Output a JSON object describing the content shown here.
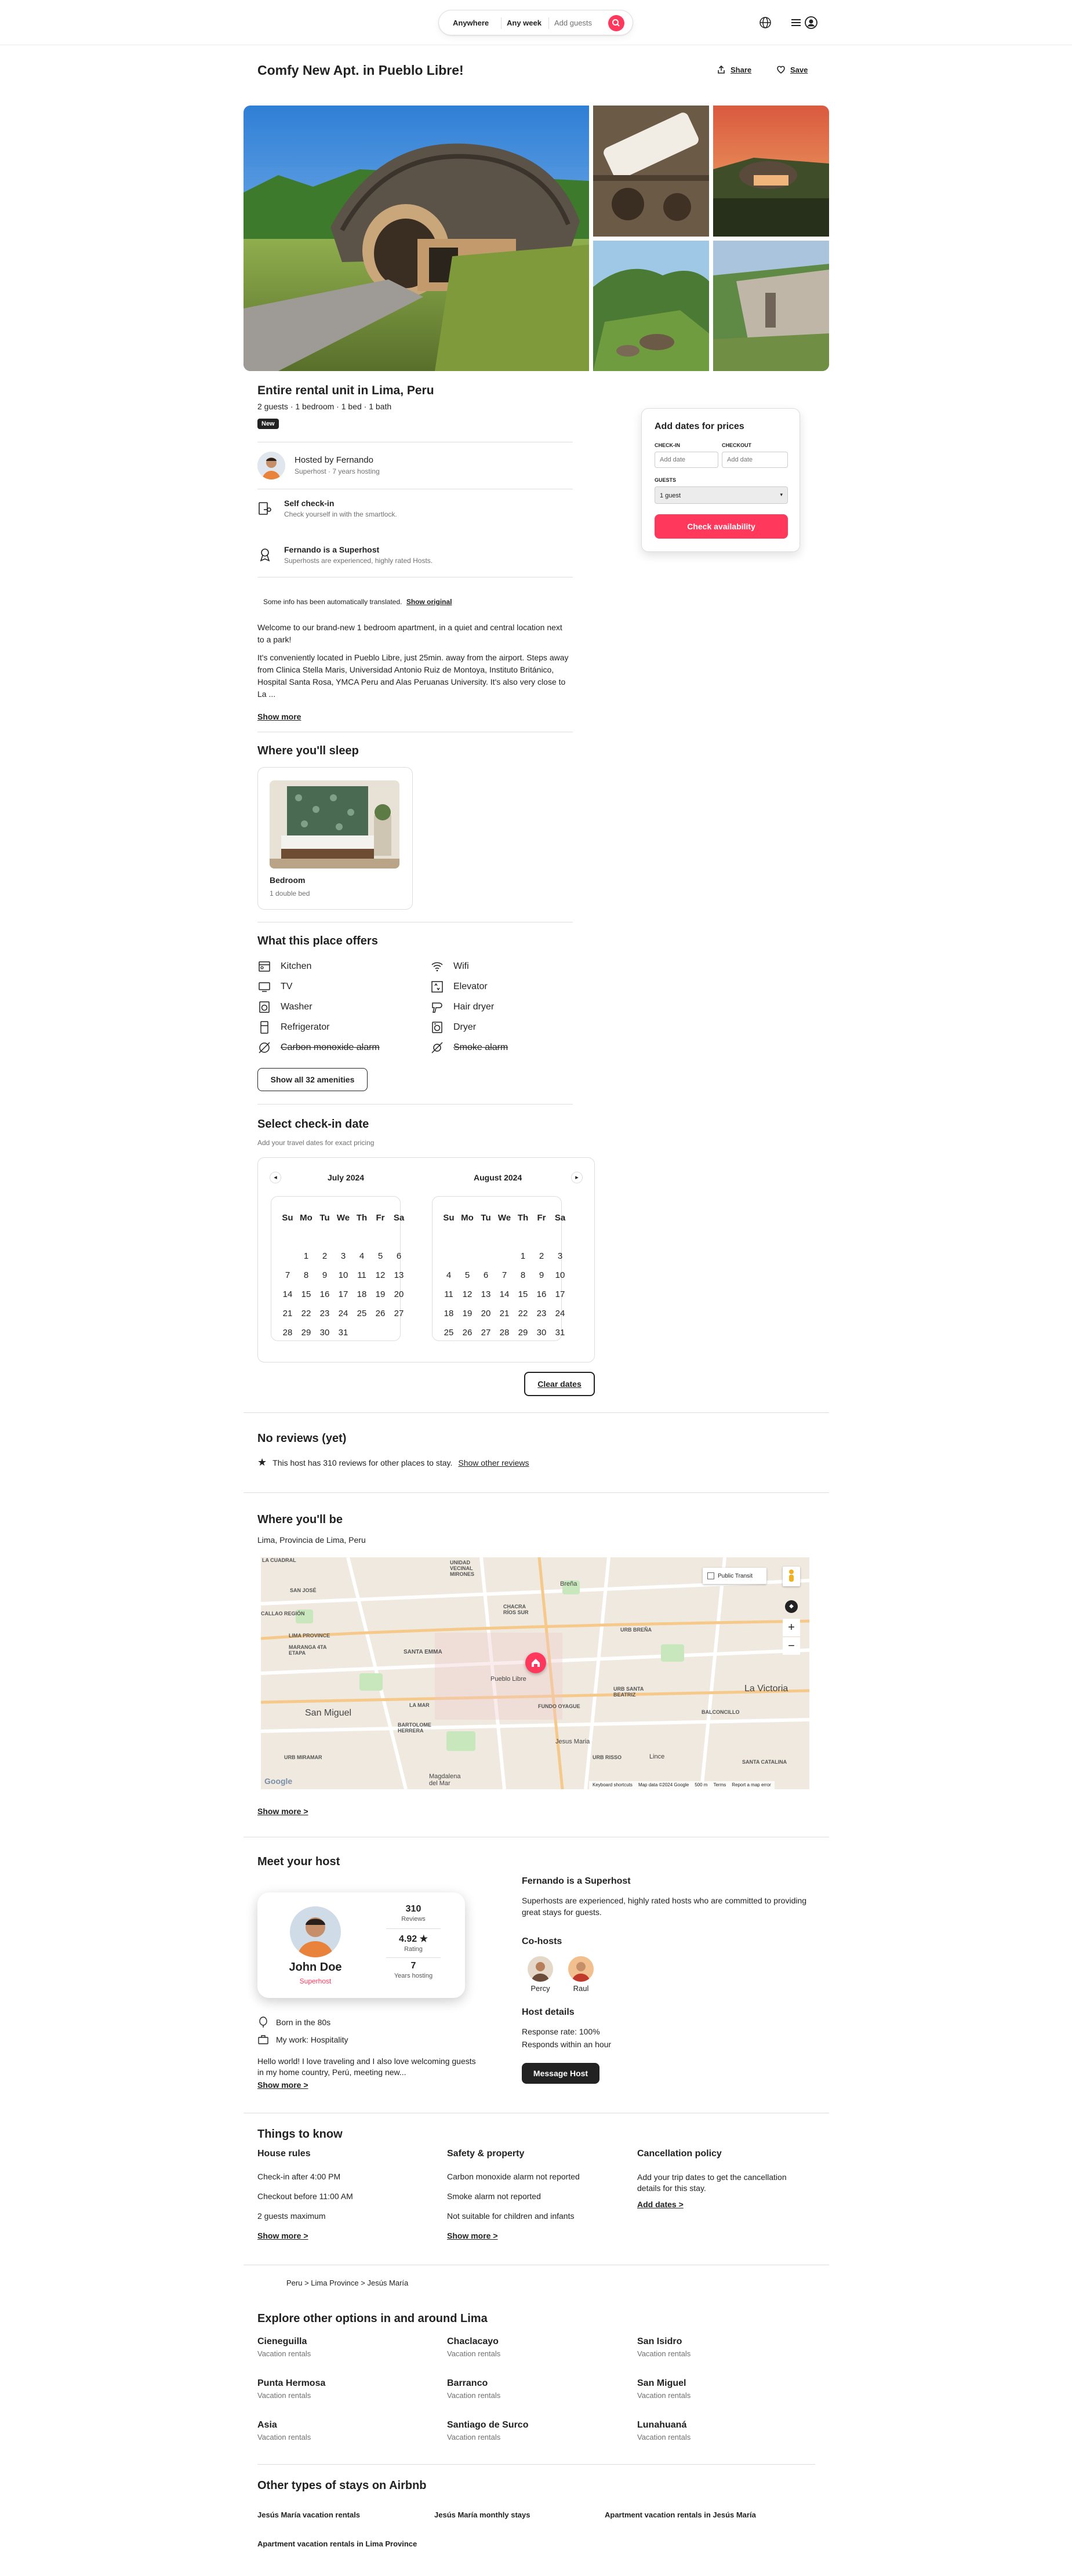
{
  "colors": {
    "accent": "#FF385C",
    "text": "#222222",
    "muted": "#717171",
    "border": "#DDDDDD"
  },
  "header": {
    "search": {
      "anywhere": "Anywhere",
      "anyweek": "Any week",
      "guests": "Add guests"
    },
    "icons": {
      "search": "search-icon",
      "globe": "globe-icon",
      "menu": "menu-icon",
      "user": "user-icon"
    }
  },
  "listing": {
    "title": "Comfy New Apt. in Pueblo Libre!",
    "share": "Share",
    "save": "Save",
    "type": "Entire rental unit in Lima, Peru",
    "summary": "2 guests · 1 bedroom · 1 bed · 1 bath",
    "badge": "New"
  },
  "host_brief": {
    "hosted_by": "Hosted by Fernando",
    "sub": "Superhost · 7 years hosting"
  },
  "highlights": [
    {
      "title": "Self check-in",
      "desc": "Check yourself in with the smartlock."
    },
    {
      "title": "Fernando is a Superhost",
      "desc": "Superhosts are experienced, highly rated Hosts."
    }
  ],
  "translation": {
    "text": "Some info has been automatically translated.",
    "link": "Show original"
  },
  "description": {
    "p1": "Welcome to our brand-new 1 bedroom apartment, in a quiet and central location next to a park!",
    "p2": "It's conveniently located in Pueblo Libre, just 25min. away from the airport. Steps away from Clinica Stella Maris, Universidad Antonio Ruiz de Montoya, Instituto Británico, Hospital Santa Rosa, YMCA Peru and Alas Peruanas University. It's also very close to La ...",
    "show_more": "Show more"
  },
  "booking": {
    "title": "Add dates for prices",
    "checkin_label": "CHECK-IN",
    "checkout_label": "CHECKOUT",
    "checkin_placeholder": "Add date",
    "checkout_placeholder": "Add date",
    "guests_label": "GUESTS",
    "guests_value": "1 guest",
    "cta": "Check availability"
  },
  "sleep": {
    "heading": "Where you'll sleep",
    "room": "Bedroom",
    "bed": "1 double bed"
  },
  "amenities": {
    "heading": "What this place offers",
    "left": [
      "Kitchen",
      "TV",
      "Washer",
      "Refrigerator",
      "Carbon monoxide alarm"
    ],
    "right": [
      "Wifi",
      "Elevator",
      "Hair dryer",
      "Dryer",
      "Smoke alarm"
    ],
    "icons_left": [
      "kitchen-icon",
      "tv-icon",
      "washer-icon",
      "refrigerator-icon",
      "carbon-monoxide-icon"
    ],
    "icons_right": [
      "wifi-icon",
      "elevator-icon",
      "hair-dryer-icon",
      "dryer-icon",
      "smoke-alarm-icon"
    ],
    "show_all": "Show all 32 amenities"
  },
  "calendar": {
    "heading": "Select check-in date",
    "sub": "Add your travel dates for exact pricing",
    "weekdays": [
      "Su",
      "Mo",
      "Tu",
      "We",
      "Th",
      "Fr",
      "Sa"
    ],
    "months": [
      {
        "name": "July 2024",
        "offset": 1,
        "days": 31
      },
      {
        "name": "August 2024",
        "offset": 4,
        "days": 31
      }
    ],
    "clear": "Clear dates"
  },
  "reviews": {
    "heading": "No reviews (yet)",
    "text": "This host has 310 reviews for other places to stay.",
    "link": "Show other reviews"
  },
  "location": {
    "heading": "Where you'll be",
    "place": "Lima, Provincia de Lima, Peru",
    "show_more": "Show more >",
    "map": {
      "transit": "Public Transit",
      "labels": [
        "LA CUADRAL",
        "UNIDAD VECINAL MIRONES",
        "Breña",
        "SAN JOSÉ",
        "CALLAO REGIÓN",
        "CHACRA RÍOS SUR",
        "LIMA PROVINCE",
        "MARANGA 4TA ETAPA",
        "SANTA EMMA",
        "URB BREÑA",
        "Pueblo Libre",
        "URB SANTA BEATRIZ",
        "La Victoria",
        "San Miguel",
        "LA MAR",
        "FUNDO OYAGUE",
        "BALCONCILLO",
        "BARTOLOME HERRERA",
        "Jesus Maria",
        "URB MIRAMAR",
        "URB RISSO",
        "Lince",
        "SANTA CATALINA",
        "Magdalena del Mar"
      ],
      "footer": [
        "Keyboard shortcuts",
        "Map data ©2024 Google",
        "500 m",
        "Terms",
        "Report a map error"
      ],
      "google": "Google"
    }
  },
  "host": {
    "heading": "Meet your host",
    "name": "John Doe",
    "badge": "Superhost",
    "stats": [
      {
        "value": "310",
        "label": "Reviews"
      },
      {
        "value": "4.92 ★",
        "label": "Rating"
      },
      {
        "value": "7",
        "label": "Years hosting"
      }
    ],
    "born": "Born in the 80s",
    "work": "My work: Hospitality",
    "bio": "Hello world! I love traveling and I also love welcoming guests in my home country, Perú, meeting new...",
    "show_more": "Show more >",
    "superhost_title": "Fernando is a Superhost",
    "superhost_text": "Superhosts are experienced, highly rated hosts who are committed to providing great stays for guests.",
    "cohosts_heading": "Co-hosts",
    "cohosts": [
      "Percy",
      "Raul"
    ],
    "details_heading": "Host details",
    "response_rate": "Response rate: 100%",
    "response_time": "Responds within an hour",
    "message": "Message Host"
  },
  "things": {
    "heading": "Things to know",
    "cols": [
      {
        "title": "House rules",
        "items": [
          "Check-in after 4:00 PM",
          "Checkout before 11:00 AM",
          "2 guests maximum"
        ],
        "link": "Show more >"
      },
      {
        "title": "Safety & property",
        "items": [
          "Carbon monoxide alarm not reported",
          "Smoke alarm not reported",
          "Not suitable for children and infants"
        ],
        "link": "Show more >"
      },
      {
        "title": "Cancellation policy",
        "items": [
          "Add your trip dates to get the cancellation details for this stay."
        ],
        "link": "Add dates >"
      }
    ]
  },
  "breadcrumb": "Peru > Lima Province > Jesús María",
  "explore": {
    "heading": "Explore other options in and around Lima",
    "items": [
      {
        "name": "Cieneguilla",
        "sub": "Vacation rentals"
      },
      {
        "name": "Chaclacayo",
        "sub": "Vacation rentals"
      },
      {
        "name": "San Isidro",
        "sub": "Vacation rentals"
      },
      {
        "name": "Punta Hermosa",
        "sub": "Vacation rentals"
      },
      {
        "name": "Barranco",
        "sub": "Vacation rentals"
      },
      {
        "name": "San Miguel",
        "sub": "Vacation rentals"
      },
      {
        "name": "Asia",
        "sub": "Vacation rentals"
      },
      {
        "name": "Santiago de Surco",
        "sub": "Vacation rentals"
      },
      {
        "name": "Lunahuaná",
        "sub": "Vacation rentals"
      }
    ]
  },
  "other_types": {
    "heading": "Other types of stays on Airbnb",
    "links": [
      "Jesús María vacation rentals",
      "Jesús María monthly stays",
      "Apartment vacation rentals in Jesús María",
      "Apartment vacation rentals in Lima Province"
    ]
  }
}
